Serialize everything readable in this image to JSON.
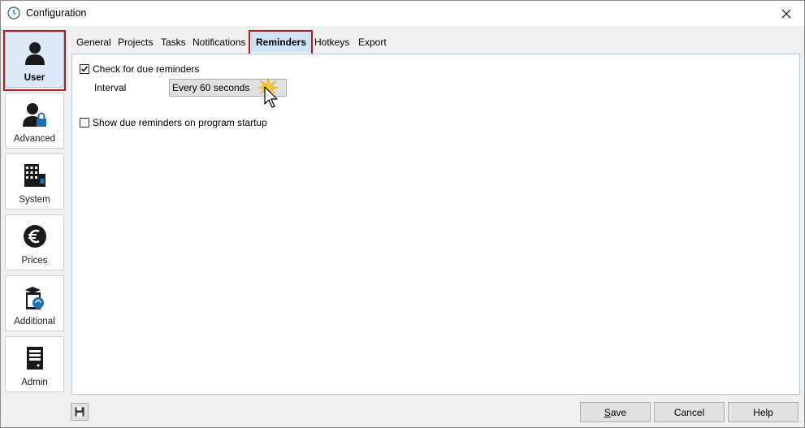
{
  "window": {
    "title": "Configuration"
  },
  "nav": {
    "items": [
      {
        "label": "User",
        "icon": "user-icon",
        "active": true
      },
      {
        "label": "Advanced",
        "icon": "user-lock-icon"
      },
      {
        "label": "System",
        "icon": "building-icon"
      },
      {
        "label": "Prices",
        "icon": "euro-icon"
      },
      {
        "label": "Additional",
        "icon": "box-plugin-icon"
      },
      {
        "label": "Admin",
        "icon": "server-icon"
      }
    ]
  },
  "tabs": [
    {
      "label": "General"
    },
    {
      "label": "Projects"
    },
    {
      "label": "Tasks"
    },
    {
      "label": "Notifications"
    },
    {
      "label": "Reminders",
      "active": true
    },
    {
      "label": "Hotkeys"
    },
    {
      "label": "Export"
    }
  ],
  "reminders": {
    "check_due_label": "Check for due reminders",
    "check_due_checked": true,
    "interval_label": "Interval",
    "interval_value": "Every 60 seconds",
    "show_on_startup_label": "Show due reminders on program startup",
    "show_on_startup_checked": false
  },
  "footer": {
    "save_label_underlined": "S",
    "save_label_rest": "ave",
    "cancel_label": "Cancel",
    "help_label": "Help"
  },
  "colors": {
    "highlight_border": "#b01e22",
    "active_tab": "#cde3f5",
    "active_nav": "#dceaf7"
  }
}
